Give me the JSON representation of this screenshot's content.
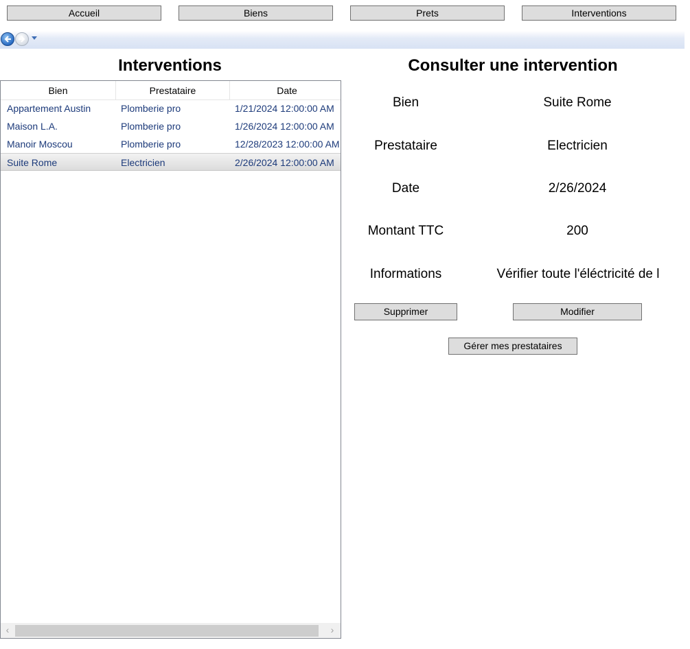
{
  "topnav": {
    "accueil": "Accueil",
    "biens": "Biens",
    "prets": "Prets",
    "interventions": "Interventions"
  },
  "list": {
    "title": "Interventions",
    "columns": [
      "Bien",
      "Prestataire",
      "Date"
    ],
    "rows": [
      {
        "bien": "Appartement Austin",
        "prestataire": "Plomberie pro",
        "date": "1/21/2024 12:00:00 AM"
      },
      {
        "bien": "Maison L.A.",
        "prestataire": "Plomberie pro",
        "date": "1/26/2024 12:00:00 AM"
      },
      {
        "bien": "Manoir Moscou",
        "prestataire": "Plomberie pro",
        "date": "12/28/2023 12:00:00 AM"
      },
      {
        "bien": "Suite Rome",
        "prestataire": "Electricien",
        "date": "2/26/2024 12:00:00 AM"
      }
    ]
  },
  "detail": {
    "title": "Consulter une intervention",
    "bien_label": "Bien",
    "bien_value": "Suite Rome",
    "prestataire_label": "Prestataire",
    "prestataire_value": "Electricien",
    "date_label": "Date",
    "date_value": "2/26/2024",
    "montant_label": "Montant TTC",
    "montant_value": "200",
    "info_label": "Informations",
    "info_value": "Vérifier toute l'éléctricité de l",
    "supprimer": "Supprimer",
    "modifier": "Modifier",
    "gerer": "Gérer mes prestataires"
  },
  "colors": {
    "button_bg": "#dddddd",
    "row_text": "#1c3a7a",
    "selected_row": "#e0e0e0"
  }
}
